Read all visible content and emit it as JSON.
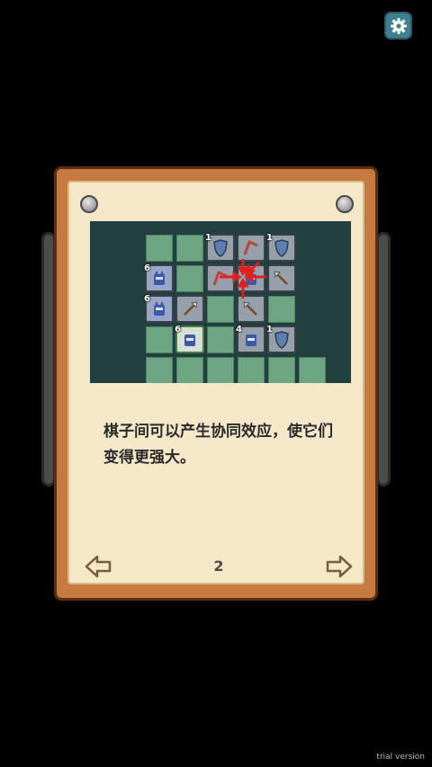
{
  "settings": {
    "icon": "gear-icon"
  },
  "tutorial": {
    "line1": "棋子间可以产生协同效应，使它们",
    "line2": "变得更强大。",
    "page": "2"
  },
  "units": [
    {
      "badge": "1",
      "kind": "shield"
    },
    {
      "badge": "",
      "kind": "boomerang"
    },
    {
      "badge": "1",
      "kind": "shield"
    },
    {
      "badge": "6",
      "kind": "knight"
    },
    {
      "badge": "",
      "kind": "boomerang"
    },
    {
      "badge": "",
      "kind": "knight"
    },
    {
      "badge": "",
      "kind": "spear"
    },
    {
      "badge": "6",
      "kind": "knight"
    },
    {
      "badge": "",
      "kind": "spear"
    },
    {
      "badge": "",
      "kind": "spear"
    },
    {
      "badge": "6",
      "kind": "soldier"
    },
    {
      "badge": "4",
      "kind": "soldier"
    },
    {
      "badge": "1",
      "kind": "shield"
    }
  ],
  "watermark": "trial version",
  "colors": {
    "frame": "#c57a3f",
    "paper": "#f5e8c9",
    "cell": "#6ea583",
    "accent": "#3f7f8e"
  }
}
